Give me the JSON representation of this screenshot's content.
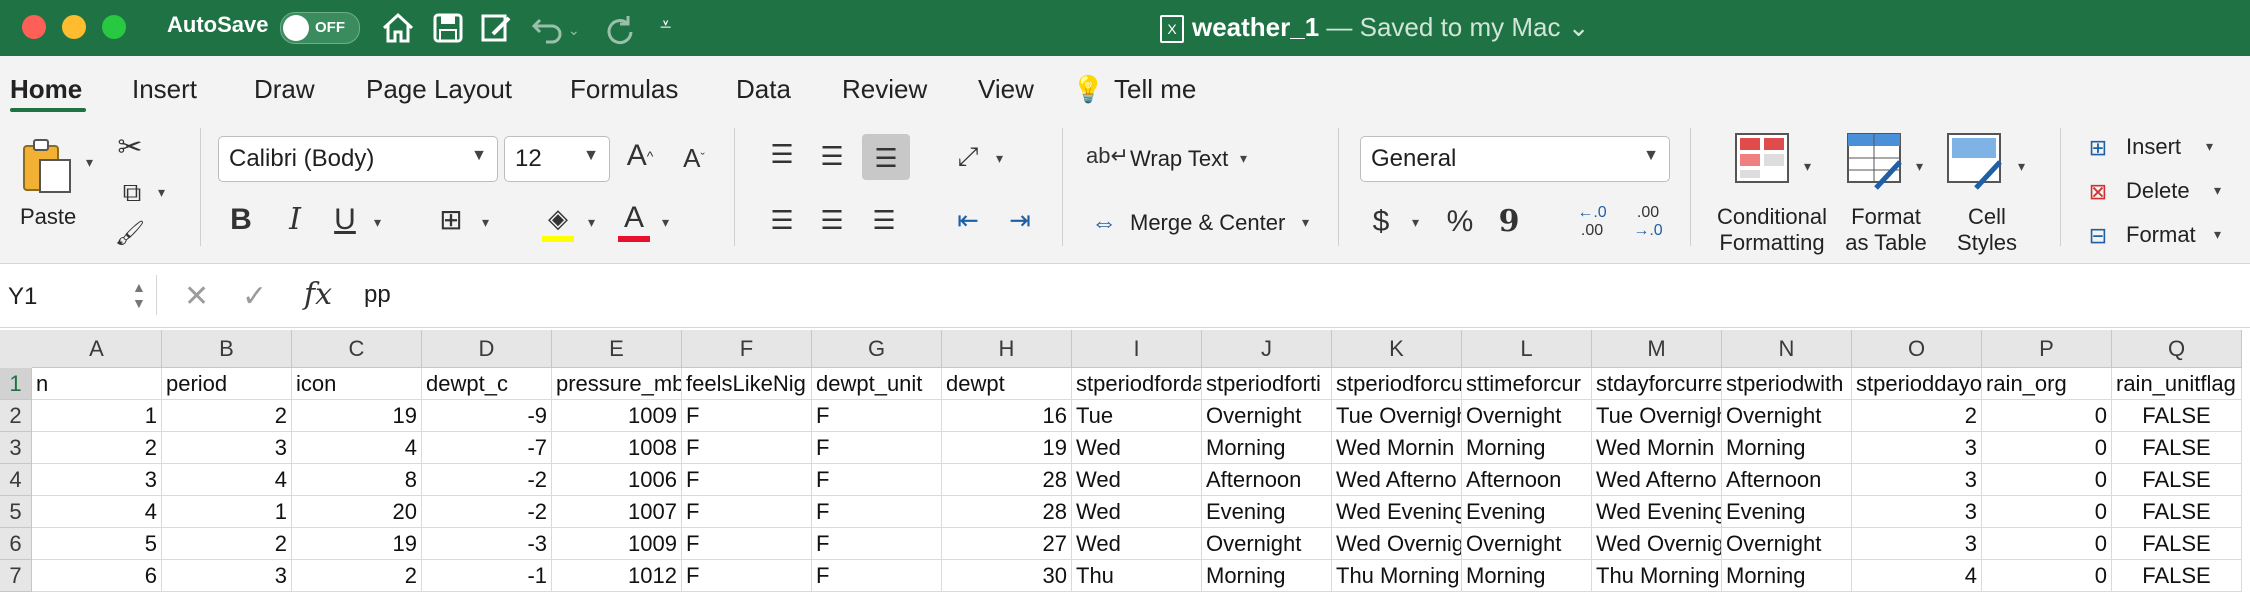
{
  "titlebar": {
    "autosave_label": "AutoSave",
    "autosave_state": "OFF",
    "doc_name": "weather_1",
    "doc_saved": " — Saved to my Mac",
    "bg_color": "#1f7244"
  },
  "tabs": [
    "Home",
    "Insert",
    "Draw",
    "Page Layout",
    "Formulas",
    "Data",
    "Review",
    "View"
  ],
  "tell_me": "Tell me",
  "ribbon": {
    "paste_label": "Paste",
    "font_name": "Calibri (Body)",
    "font_size": "12",
    "wrap_text": "Wrap Text",
    "merge_center": "Merge & Center",
    "number_format": "General",
    "cond_fmt_1": "Conditional",
    "cond_fmt_2": "Formatting",
    "fmt_table_1": "Format",
    "fmt_table_2": "as Table",
    "cell_styles_1": "Cell",
    "cell_styles_2": "Styles",
    "insert": "Insert",
    "delete": "Delete",
    "format": "Format",
    "bold": "B",
    "italic": "I",
    "underline": "U",
    "dollar": "$",
    "percent": "%",
    "comma": "9",
    "dec_inc_top": "←.0",
    "dec_inc_bottom": ".00",
    "dec_dec_top": ".00",
    "dec_dec_bottom": "→.0"
  },
  "formula_bar": {
    "cell_ref": "Y1",
    "value": "pp",
    "fx": "fx"
  },
  "columns": [
    "A",
    "B",
    "C",
    "D",
    "E",
    "F",
    "G",
    "H",
    "I",
    "J",
    "K",
    "L",
    "M",
    "N",
    "O",
    "P",
    "Q"
  ],
  "rows": [
    [
      "n",
      "period",
      "icon",
      "dewpt_c",
      "pressure_mb",
      "feelsLikeNig",
      "dewpt_unit",
      "dewpt",
      "stperiodforda",
      "stperiodforti",
      "stperiodforcu",
      "sttimeforcur",
      "stdayforcurre",
      "stperiodwith",
      "stperioddayo",
      "rain_org",
      "rain_unitflag"
    ],
    [
      "1",
      "2",
      "19",
      "-9",
      "1009",
      "F",
      "F",
      "16",
      "Tue",
      "Overnight",
      "Tue Overnigh",
      "Overnight",
      "Tue Overnigh",
      "Overnight",
      "2",
      "0",
      "FALSE"
    ],
    [
      "2",
      "3",
      "4",
      "-7",
      "1008",
      "F",
      "F",
      "19",
      "Wed",
      "Morning",
      "Wed Mornin",
      "Morning",
      "Wed Mornin",
      "Morning",
      "3",
      "0",
      "FALSE"
    ],
    [
      "3",
      "4",
      "8",
      "-2",
      "1006",
      "F",
      "F",
      "28",
      "Wed",
      "Afternoon",
      "Wed Afterno",
      "Afternoon",
      "Wed Afterno",
      "Afternoon",
      "3",
      "0",
      "FALSE"
    ],
    [
      "4",
      "1",
      "20",
      "-2",
      "1007",
      "F",
      "F",
      "28",
      "Wed",
      "Evening",
      "Wed Evening",
      "Evening",
      "Wed Evening",
      "Evening",
      "3",
      "0",
      "FALSE"
    ],
    [
      "5",
      "2",
      "19",
      "-3",
      "1009",
      "F",
      "F",
      "27",
      "Wed",
      "Overnight",
      "Wed Overnig",
      "Overnight",
      "Wed Overnig",
      "Overnight",
      "3",
      "0",
      "FALSE"
    ],
    [
      "6",
      "3",
      "2",
      "-1",
      "1012",
      "F",
      "F",
      "30",
      "Thu",
      "Morning",
      "Thu Morning",
      "Morning",
      "Thu Morning",
      "Morning",
      "4",
      "0",
      "FALSE"
    ]
  ],
  "row_numbers": [
    "1",
    "2",
    "3",
    "4",
    "5",
    "6",
    "7"
  ]
}
